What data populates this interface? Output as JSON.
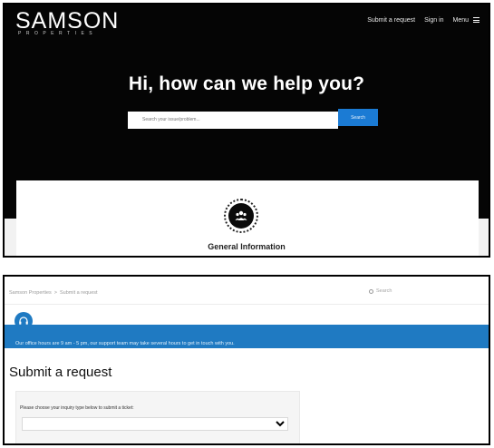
{
  "header": {
    "logo_main": "SAMSON",
    "logo_sub": "PROPERTIES",
    "nav": {
      "submit_request": "Submit a request",
      "sign_in": "Sign in",
      "menu": "Menu"
    }
  },
  "hero": {
    "title": "Hi, how can we help you?",
    "search_placeholder": "Search your issue/problem...",
    "search_button": "Search"
  },
  "category_card": {
    "title": "General Information",
    "icon": "people-icon"
  },
  "request_page": {
    "breadcrumb": [
      "Samson Properties",
      "Submit a request"
    ],
    "search_label": "Search",
    "banner_text": "Our office hours are 9 am - 5 pm, our support team may take several hours to get in touch with you.",
    "heading": "Submit a request",
    "form_label": "Please choose your inquiry type below to submit a ticket:",
    "select_value": ""
  },
  "colors": {
    "hero_bg": "#050505",
    "accent_blue": "#1b7bd4",
    "banner_blue": "#1f7ac2"
  }
}
